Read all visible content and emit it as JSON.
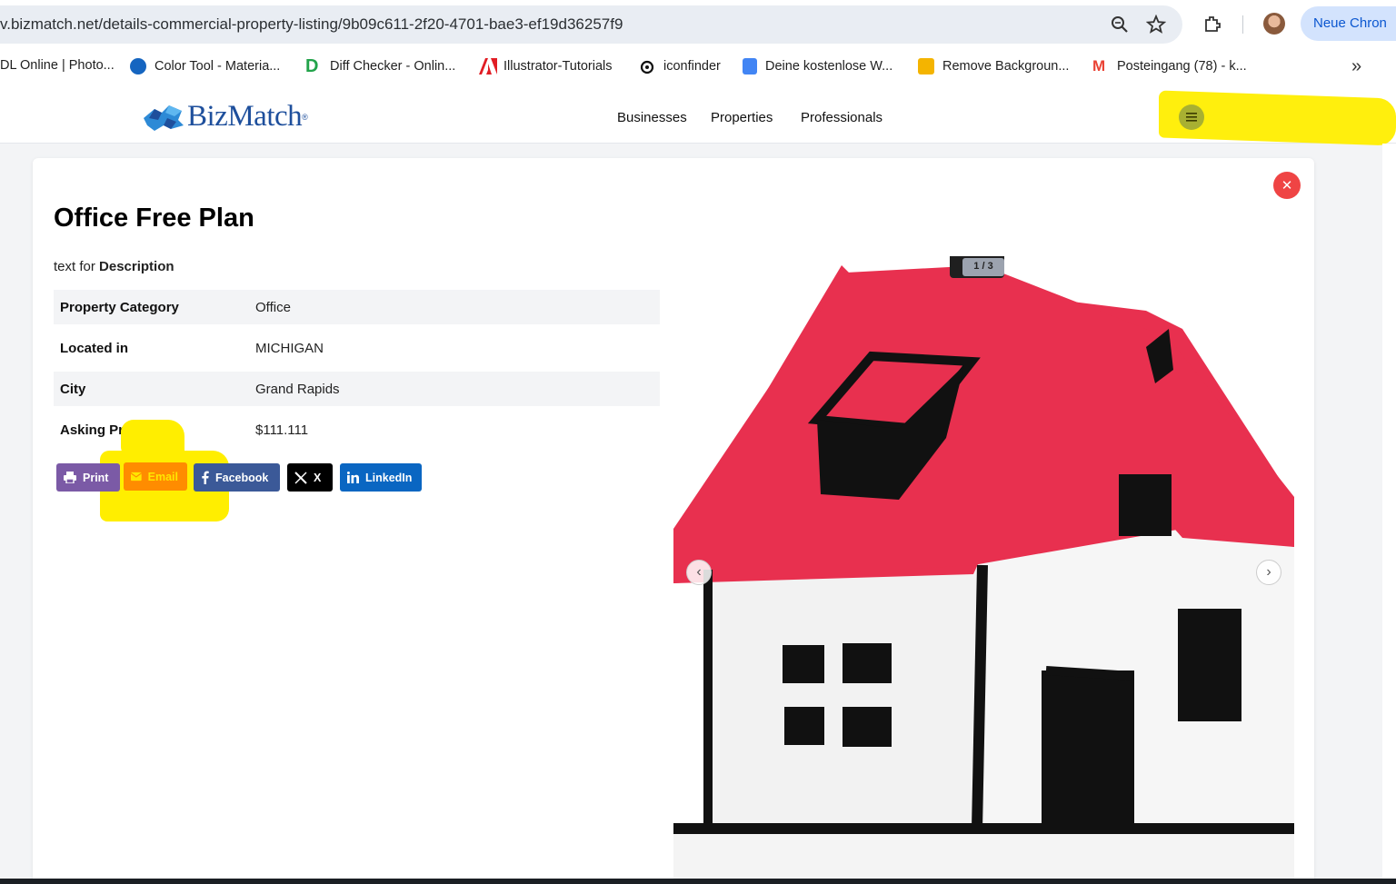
{
  "browser": {
    "url": "v.bizmatch.net/details-commercial-property-listing/9b09c611-2f20-4701-bae3-ef19d36257f9",
    "profile_button": "Neue Chron",
    "bookmarks": [
      {
        "label": "DL Online | Photo...",
        "icon": "photo-icon"
      },
      {
        "label": "Color Tool - Materia...",
        "icon": "color-tool-icon"
      },
      {
        "label": "Diff Checker - Onlin...",
        "icon": "diff-checker-icon"
      },
      {
        "label": "Illustrator-Tutorials",
        "icon": "adobe-icon"
      },
      {
        "label": "iconfinder",
        "icon": "iconfinder-icon"
      },
      {
        "label": "Deine kostenlose W...",
        "icon": "google-docs-icon"
      },
      {
        "label": "Remove Backgroun...",
        "icon": "remove-bg-icon"
      },
      {
        "label": "Posteingang (78) - k...",
        "icon": "gmail-icon"
      }
    ]
  },
  "site": {
    "logo_text": "BizMatch",
    "logo_reg": "®",
    "nav": [
      "Businesses",
      "Properties",
      "Professionals"
    ]
  },
  "listing": {
    "title": "Office Free Plan",
    "description_prefix": "text for ",
    "description_bold": "Description",
    "details": [
      {
        "label": "Property Category",
        "value": "Office"
      },
      {
        "label": "Located in",
        "value": "MICHIGAN"
      },
      {
        "label": "City",
        "value": "Grand Rapids"
      },
      {
        "label": "Asking Price:",
        "value": "$111.111"
      }
    ],
    "share": [
      {
        "label": "Print",
        "color": "#7b5aa6"
      },
      {
        "label": "Email",
        "color": "#ff8c00"
      },
      {
        "label": "Facebook",
        "color": "#3b5998"
      },
      {
        "label": "X",
        "color": "#000000"
      },
      {
        "label": "LinkedIn",
        "color": "#0a66c2"
      }
    ],
    "gallery_counter": "1 / 3"
  },
  "colors": {
    "roof": "#e8304f",
    "close": "#ef4444",
    "highlight": "#ffee00"
  }
}
